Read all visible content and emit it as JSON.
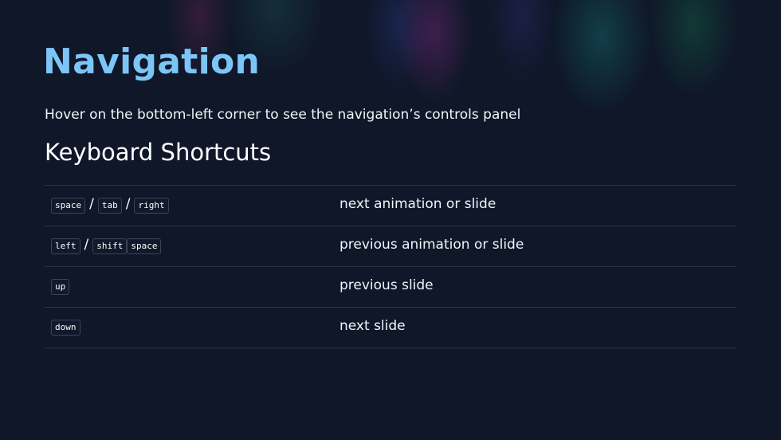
{
  "page": {
    "title": "Navigation",
    "subtitle": "Hover on the bottom-left corner to see the navigation’s controls panel",
    "section_heading": "Keyboard Shortcuts"
  },
  "shortcuts": [
    {
      "keys": [
        "space",
        "tab",
        "right"
      ],
      "separators": [
        "/",
        "/"
      ],
      "description": "next animation or slide"
    },
    {
      "keys": [
        "left",
        "shift",
        "space"
      ],
      "separators": [
        "/"
      ],
      "description": "previous animation or slide"
    },
    {
      "keys": [
        "up"
      ],
      "separators": [],
      "description": "previous slide"
    },
    {
      "keys": [
        "down"
      ],
      "separators": [],
      "description": "next slide"
    }
  ],
  "colors": {
    "background": "#0f1729",
    "title": "#7cc6f7",
    "text": "#f2f4f8",
    "divider": "#2b3447",
    "kbd_border": "#3a4458"
  }
}
